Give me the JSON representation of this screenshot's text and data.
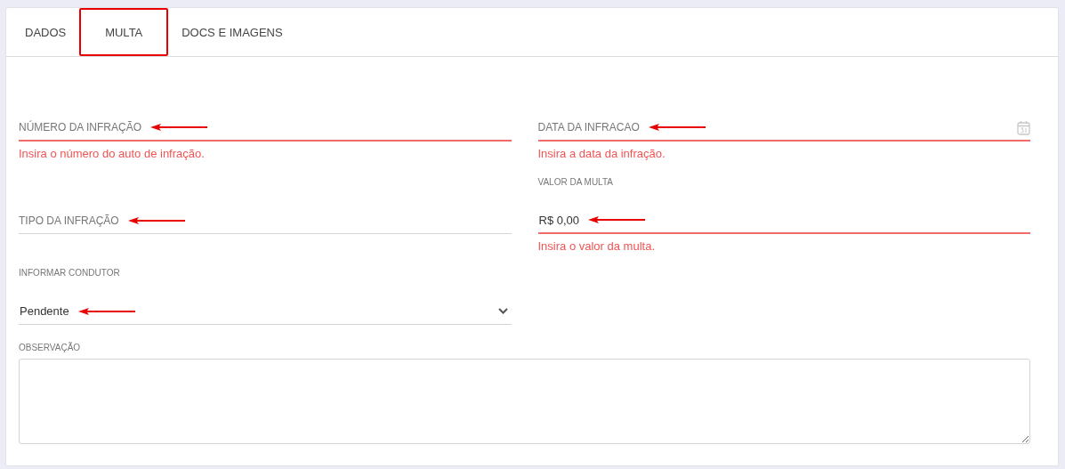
{
  "tabs": [
    {
      "label": "DADOS",
      "selected": false
    },
    {
      "label": "MULTA",
      "selected": true
    },
    {
      "label": "DOCS E IMAGENS",
      "selected": false
    }
  ],
  "columns": [
    [
      {
        "kind": "text",
        "placeholder": "NÚMERO DA INFRAÇÃO",
        "error": "Insira o número do auto de infração.",
        "annotated": true
      },
      {
        "kind": "text",
        "placeholder": "TIPO DA INFRAÇÃO",
        "annotated": true
      },
      {
        "kind": "select",
        "label": "INFORMAR CONDUTOR",
        "value": "Pendente",
        "annotated": true
      }
    ],
    [
      {
        "kind": "date",
        "placeholder": "DATA DA INFRACAO",
        "error": "Insira a data da infração.",
        "annotated": true
      },
      {
        "kind": "text",
        "label": "VALOR DA MULTA",
        "value": "R$ 0,00",
        "error": "Insira o valor da multa.",
        "annotated": true
      }
    ]
  ],
  "notes": {
    "label": "OBSERVAÇÃO"
  }
}
